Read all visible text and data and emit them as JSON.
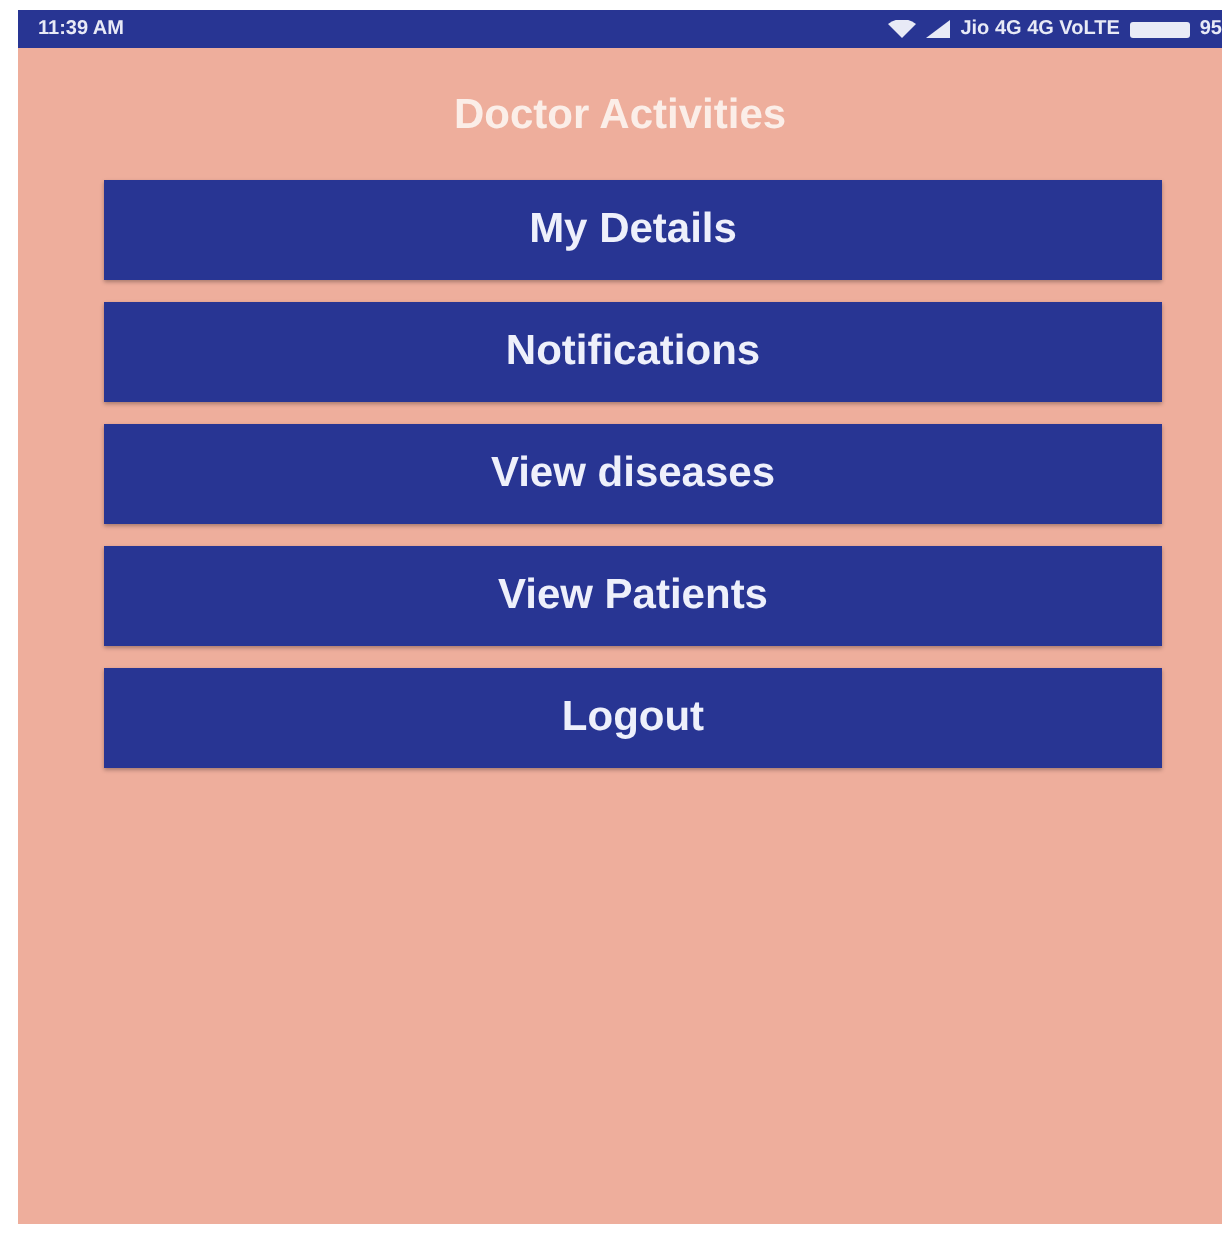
{
  "status_bar": {
    "time": "11:39 AM",
    "carrier": "Jio 4G 4G VoLTE",
    "battery": "95"
  },
  "title": "Doctor Activities",
  "buttons": [
    "My Details",
    "Notifications",
    "View diseases",
    "View Patients",
    "Logout"
  ]
}
